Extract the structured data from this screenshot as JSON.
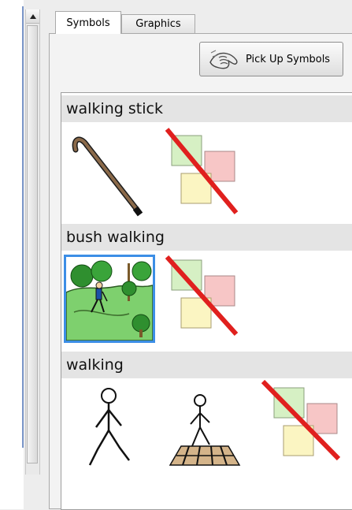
{
  "tabs": [
    {
      "label": "Symbols",
      "active": true
    },
    {
      "label": "Graphics",
      "active": false
    }
  ],
  "pickup_button": {
    "label": "Pick Up Symbols",
    "icon": "hand-grab-icon"
  },
  "groups": [
    {
      "title": "walking stick",
      "symbols": [
        "walking-stick-icon",
        "no-symbol-icon"
      ]
    },
    {
      "title": "bush walking",
      "symbols": [
        "bush-walking-icon",
        "no-symbol-icon"
      ],
      "selected": "bush-walking-icon"
    },
    {
      "title": "walking",
      "symbols": [
        "walking-person-icon",
        "pedestrian-crossing-icon",
        "no-symbol-icon"
      ]
    }
  ],
  "colors": {
    "selection": "#3c8ee6",
    "header_bg": "#e4e4e4",
    "no_symbol_slash": "#e0201e"
  }
}
